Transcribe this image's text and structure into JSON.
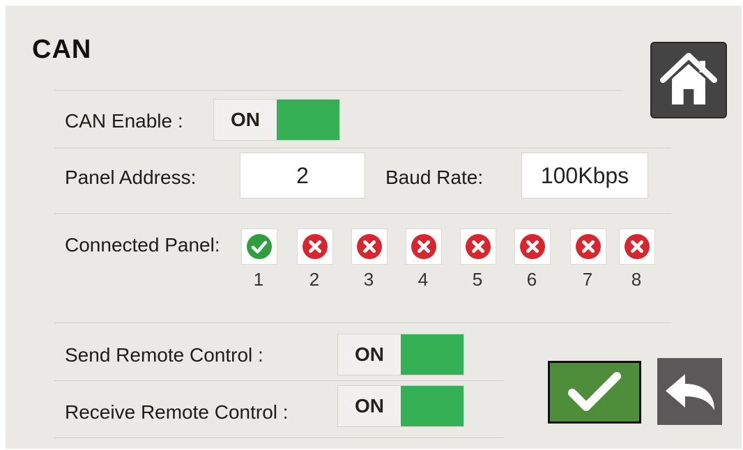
{
  "title": "CAN",
  "can_enable": {
    "label": "CAN Enable :",
    "state": "ON"
  },
  "panel_address": {
    "label": "Panel Address:",
    "value": "2"
  },
  "baud_rate": {
    "label": "Baud Rate:",
    "value": "100Kbps"
  },
  "connected_panel": {
    "label": "Connected Panel:",
    "panels": [
      {
        "number": "1",
        "status": "connected"
      },
      {
        "number": "2",
        "status": "disconnected"
      },
      {
        "number": "3",
        "status": "disconnected"
      },
      {
        "number": "4",
        "status": "disconnected"
      },
      {
        "number": "5",
        "status": "disconnected"
      },
      {
        "number": "6",
        "status": "disconnected"
      },
      {
        "number": "7",
        "status": "disconnected"
      },
      {
        "number": "8",
        "status": "disconnected"
      }
    ]
  },
  "send_remote": {
    "label": "Send Remote Control :",
    "state": "ON"
  },
  "receive_remote": {
    "label": "Receive Remote Control :",
    "state": "ON"
  },
  "icons": {
    "home": "home-icon",
    "confirm": "checkmark-icon",
    "back": "back-arrow-icon"
  },
  "colors": {
    "toggle_on": "#35b055",
    "connected": "#2e9e3e",
    "disconnected": "#d8262e",
    "confirm": "#4e8d3a"
  }
}
